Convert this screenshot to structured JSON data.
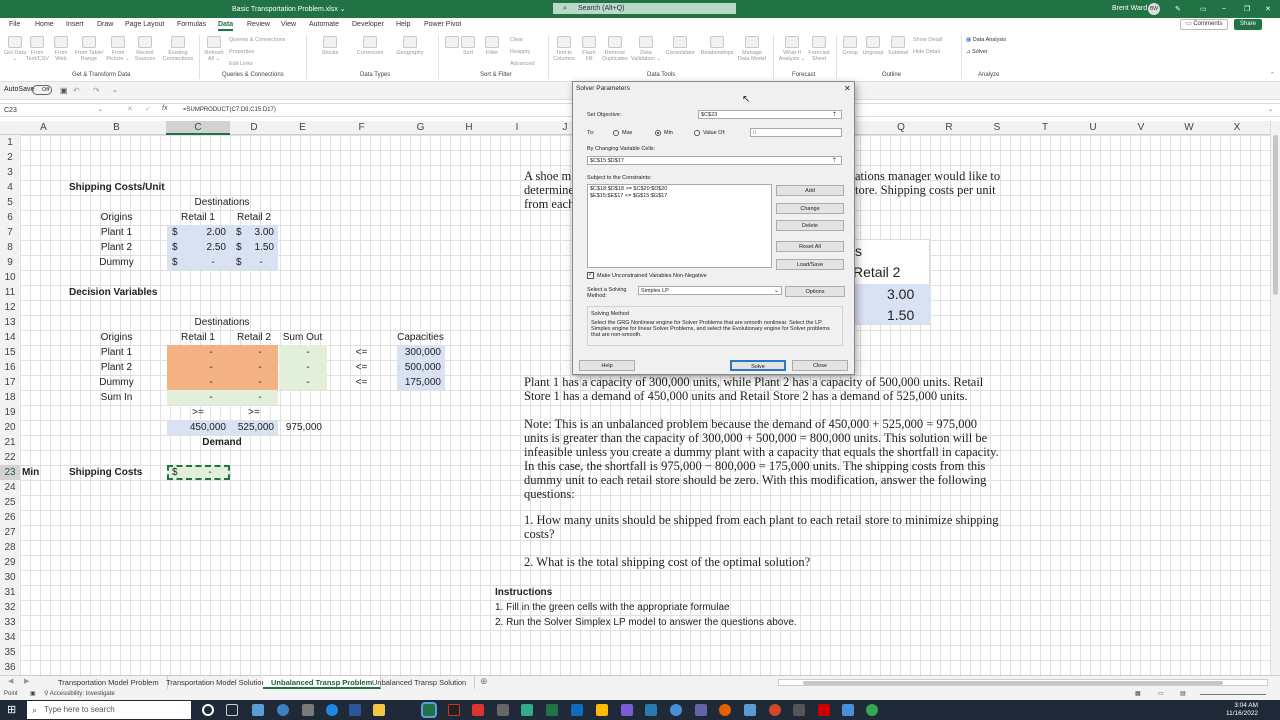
{
  "window": {
    "title": "Basic Transportation Problem.xlsx ⌄",
    "search": "Search (Alt+Q)",
    "user": "Brent Ward",
    "user_initials": "BW",
    "minimize": "–",
    "restore": "❐",
    "close": "✕"
  },
  "menu": {
    "items": [
      "File",
      "Home",
      "Insert",
      "Draw",
      "Page Layout",
      "Formulas",
      "Data",
      "Review",
      "View",
      "Automate",
      "Developer",
      "Help",
      "Power Pivot"
    ],
    "active": "Data",
    "comments_label": "Comments",
    "share_label": "Share"
  },
  "ribbon": {
    "groups": [
      "Get & Transform Data",
      "Queries & Connections",
      "Data Types",
      "Sort & Filter",
      "Data Tools",
      "Forecast",
      "Outline",
      "Analyze"
    ],
    "buttons": [
      "Get Data ⌄",
      "From Text/CSV",
      "From Web",
      "From Table/ Range",
      "From Picture ⌄",
      "Recent Sources",
      "Existing Connections",
      "Refresh All ⌄",
      "Stocks",
      "Currencies",
      "Geography",
      "Sort",
      "Filter",
      "Text to Columns",
      "Flash Fill",
      "Remove Duplicates",
      "Data Validation ⌄",
      "Consolidate",
      "Relationships",
      "Manage Data Model",
      "What-If Analysis ⌄",
      "Forecast Sheet",
      "Group",
      "Ungroup",
      "Subtotal"
    ],
    "small": [
      "Queries & Connections",
      "Properties",
      "Edit Links",
      "Clear",
      "Reapply",
      "Advanced",
      "Show Detail",
      "Hide Detail",
      "Data Analysis",
      "Solver"
    ]
  },
  "qat": {
    "autosave": "AutoSave",
    "autosave_state": "Off"
  },
  "formula_bar": {
    "name_box": "C23",
    "formula": "=SUMPRODUCT(C7:D9,C15:D17)",
    "cancel": "✕",
    "enter": "✓",
    "fx": "fx"
  },
  "columns": [
    "A",
    "B",
    "C",
    "D",
    "E",
    "F",
    "G",
    "H",
    "I",
    "J",
    "K",
    "L",
    "M",
    "N",
    "O",
    "P",
    "Q",
    "R",
    "S",
    "T",
    "U",
    "V",
    "W",
    "X"
  ],
  "rows": [
    "1",
    "2",
    "3",
    "4",
    "5",
    "6",
    "7",
    "8",
    "9",
    "10",
    "11",
    "12",
    "13",
    "14",
    "15",
    "16",
    "17",
    "18",
    "19",
    "20",
    "21",
    "22",
    "23",
    "24",
    "25",
    "26",
    "27",
    "28",
    "29",
    "30",
    "31",
    "32",
    "33",
    "34",
    "35",
    "36"
  ],
  "sheet": {
    "shipping_title": "Shipping Costs/Unit",
    "destinations": "Destinations",
    "origins": "Origins",
    "retail1": "Retail 1",
    "retail2": "Retail 2",
    "cost_rows": [
      {
        "origin": "Plant 1",
        "c1": "2.00",
        "c2": "3.00"
      },
      {
        "origin": "Plant 2",
        "c1": "2.50",
        "c2": "1.50"
      },
      {
        "origin": "Dummy",
        "c1": "-",
        "c2": "-"
      }
    ],
    "dollar": "$",
    "decision_title": "Decision Variables",
    "sum_out": "Sum Out",
    "capacities": "Capacities",
    "dv_rows": [
      {
        "origin": "Plant 1",
        "x1": "-",
        "x2": "-",
        "sum": "-",
        "op": "<=",
        "cap": "300,000"
      },
      {
        "origin": "Plant 2",
        "x1": "-",
        "x2": "-",
        "sum": "-",
        "op": "<=",
        "cap": "500,000"
      },
      {
        "origin": "Dummy",
        "x1": "-",
        "x2": "-",
        "sum": "-",
        "op": "<=",
        "cap": "175,000"
      }
    ],
    "sum_in": "Sum In",
    "sum_in_1": "-",
    "sum_in_2": "-",
    "ge": ">=",
    "demand1": "450,000",
    "demand2": "525,000",
    "demand_total": "975,000",
    "demand": "Demand",
    "min": "Min",
    "shipping_costs": "Shipping Costs",
    "obj_value": "-"
  },
  "problem": {
    "p1_line1": "A shoe m",
    "p1_line1b": "ations manager would like to",
    "p1_line2": "determine",
    "p1_line2b": "tore.  Shipping costs per unit",
    "p1_line3": "from each",
    "embedded_header_frag": "s",
    "embedded_retail2": "Retail 2",
    "embedded_v1": "3.00",
    "embedded_v2": "1.50",
    "p2": "Plant 1 has a capacity of 300,000 units, while Plant 2 has a capacity of 500,000 units.  Retail Store 1 has a demand of 450,000 units and Retail Store 2 has a demand of 525,000 units.",
    "p3": "Note: This is an unbalanced problem because the demand of 450,000 + 525,000 = 975,000 units is greater than the capacity of 300,000 + 500,000 = 800,000 units.  This solution will be infeasible unless you create a dummy plant with a capacity that equals the shortfall in capacity.  In this case, the shortfall is 975,000  − 800,000 = 175,000 units.  The shipping costs from this dummy unit to each retail store should be zero.  With this modification, answer the following questions:",
    "q1": "1. How many units should be shipped from each plant to each retail store to minimize shipping costs?",
    "q2": "2. What is the total shipping cost of the optimal solution?",
    "instructions_title": "Instructions",
    "inst1": "1.  Fill in the green cells with the appropriate formulae",
    "inst2": "2.  Run the Solver Simplex LP model to answer the questions above."
  },
  "solver": {
    "title": "Solver Parameters",
    "close": "✕",
    "set_objective_label": "Set Objective:",
    "objective": "$C$23",
    "to_label": "To:",
    "max": "Max",
    "min": "Min",
    "value_of": "Value Of:",
    "value_of_value": "0",
    "selected": "Min",
    "changing_label": "By Changing Variable Cells:",
    "changing": "$C$15:$D$17",
    "constraints_label": "Subject to the Constraints:",
    "constraints": [
      "$C$18:$D$18 >= $C$20:$D$20",
      "$E$15:$E$17 <= $G$15:$G$17"
    ],
    "add": "Add",
    "change": "Change",
    "delete": "Delete",
    "reset_all": "Reset All",
    "load_save": "Load/Save",
    "nonneg_label": "Make Unconstrained Variables Non-Negative",
    "nonneg_checked": true,
    "method_label": "Select a Solving Method:",
    "method": "Simplex LP",
    "options": "Options",
    "solving_method_title": "Solving Method",
    "solving_method_text": "Select the GRG Nonlinear engine for Solver Problems that are smooth nonlinear. Select the LP Simplex engine for linear Solver Problems, and select the Evolutionary engine for Solver problems that are non-smooth.",
    "help": "Help",
    "solve": "Solve",
    "close_btn": "Close"
  },
  "tabs": {
    "items": [
      "Transportation Model Problem",
      "Transportation Model Solution",
      "Unbalanced Transp Problem",
      "Unbalanced Transp Solution"
    ],
    "active": "Unbalanced Transp Problem"
  },
  "status": {
    "mode": "Point",
    "accessibility": "Accessibility: Investigate"
  },
  "taskbar": {
    "search": "Type here to search",
    "time": "3:04 AM",
    "date": "11/16/2022"
  }
}
